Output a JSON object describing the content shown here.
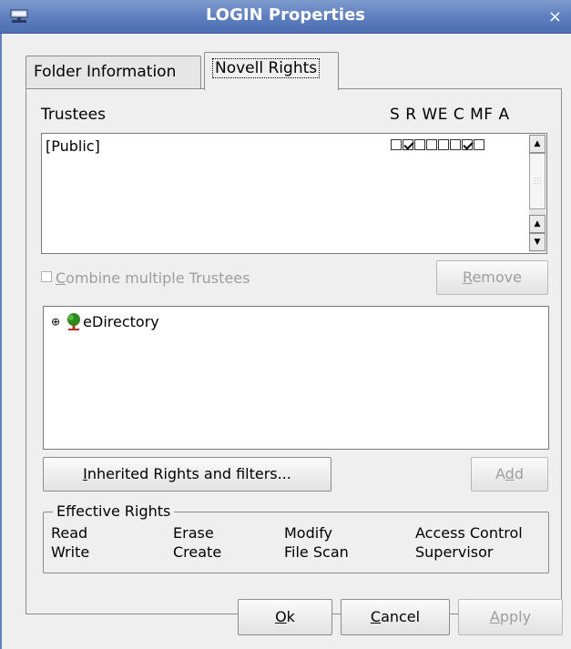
{
  "window": {
    "title": "LOGIN Properties",
    "close_glyph": "×",
    "sys_icon": "network-icon"
  },
  "tabs": [
    {
      "label": "Folder Information"
    },
    {
      "label": "Novell Rights"
    }
  ],
  "trustees": {
    "heading": "Trustees",
    "rights_header": "S R WE C MF A",
    "rows": [
      {
        "name": "[Public]",
        "rights": [
          false,
          true,
          false,
          false,
          false,
          false,
          true,
          false
        ]
      }
    ]
  },
  "combine": {
    "label_pre": "",
    "label_u": "C",
    "label_post": "ombine multiple Trustees"
  },
  "remove_button": {
    "u": "R",
    "rest": "emove"
  },
  "tree": {
    "expander": "⊕",
    "root_label": "eDirectory",
    "icon": "tree-icon"
  },
  "inherited_button": {
    "u": "I",
    "rest": "nherited Rights and filters..."
  },
  "add_button": {
    "pre": "A",
    "u": "d",
    "post": "d"
  },
  "effective_rights": {
    "legend": "Effective Rights",
    "col1": [
      "Read",
      "Write"
    ],
    "col2": [
      "Erase",
      "Create"
    ],
    "col3": [
      "Modify",
      "File Scan"
    ],
    "col4": [
      "Access Control",
      "Supervisor"
    ]
  },
  "footer": {
    "ok": {
      "u": "O",
      "rest": "k"
    },
    "cancel": {
      "u": "C",
      "rest": "ancel"
    },
    "apply": {
      "u": "A",
      "rest": "pply"
    }
  }
}
